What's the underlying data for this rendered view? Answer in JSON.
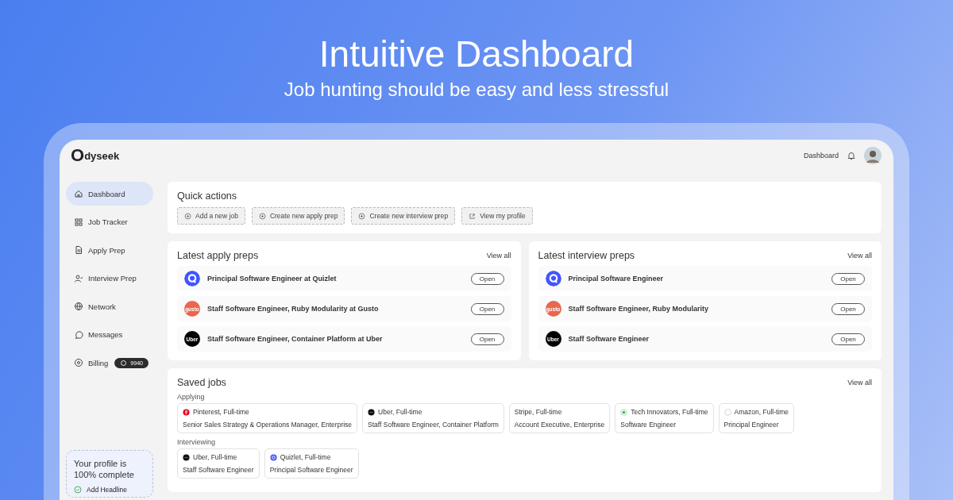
{
  "hero": {
    "title": "Intuitive Dashboard",
    "subtitle": "Job hunting should be easy and less stressful"
  },
  "brand": {
    "mark": "O",
    "name": "dyseek"
  },
  "top_bar": {
    "link": "Dashboard"
  },
  "sidebar": {
    "items": [
      {
        "label": "Dashboard",
        "selected": true
      },
      {
        "label": "Job Tracker",
        "selected": false
      },
      {
        "label": "Apply Prep",
        "selected": false
      },
      {
        "label": "Interview Prep",
        "selected": false
      },
      {
        "label": "Network",
        "selected": false
      },
      {
        "label": "Messages",
        "selected": false
      },
      {
        "label": "Billing",
        "selected": false,
        "badge": "9940"
      }
    ],
    "profile_card": {
      "title": "Your profile is 100% complete",
      "tasks": [
        {
          "label": "Add Headline",
          "checked": true
        }
      ]
    }
  },
  "quick_actions": {
    "title": "Quick actions",
    "buttons": [
      {
        "label": "Add a new job"
      },
      {
        "label": "Create new apply prep"
      },
      {
        "label": "Create new interview prep"
      },
      {
        "label": "View my profile"
      }
    ]
  },
  "prep_panels": [
    {
      "title": "Latest apply preps",
      "link": "View all",
      "rows": [
        {
          "kind": "quizlet",
          "title": "Principal Software Engineer at Quizlet",
          "button": "Open"
        },
        {
          "kind": "gusto",
          "logo_text": "gusto",
          "title": "Staff Software Engineer, Ruby Modularity at Gusto",
          "button": "Open"
        },
        {
          "kind": "uber",
          "logo_text": "Uber",
          "title": "Staff Software Engineer, Container Platform at Uber",
          "button": "Open"
        }
      ]
    },
    {
      "title": "Latest interview preps",
      "link": "View all",
      "rows": [
        {
          "kind": "quizlet",
          "title": "Principal Software Engineer",
          "button": "Open"
        },
        {
          "kind": "gusto",
          "logo_text": "gusto",
          "title": "Staff Software Engineer, Ruby Modularity",
          "button": "Open"
        },
        {
          "kind": "uber",
          "logo_text": "Uber",
          "title": "Staff Software Engineer",
          "button": "Open"
        }
      ]
    }
  ],
  "saved_jobs": {
    "title": "Saved jobs",
    "link": "View all",
    "groups": [
      {
        "label": "Applying",
        "jobs": [
          {
            "kind": "pinterest",
            "company": "Pinterest, Full-time",
            "role": "Senior Sales Strategy & Operations Manager, Enterprise"
          },
          {
            "kind": "uber",
            "company": "Uber, Full-time",
            "role": "Staff Software Engineer, Container Platform"
          },
          {
            "kind": "plain",
            "company": "Stripe, Full-time",
            "role": "Account Executive, Enterprise"
          },
          {
            "kind": "green",
            "company": "Tech Innovators, Full-time",
            "role": "Software Engineer"
          },
          {
            "kind": "empty",
            "company": "Amazon, Full-time",
            "role": "Principal Engineer"
          }
        ]
      },
      {
        "label": "Interviewing",
        "jobs": [
          {
            "kind": "uber",
            "company": "Uber, Full-time",
            "role": "Staff Software Engineer"
          },
          {
            "kind": "quizlet",
            "company": "Quizlet, Full-time",
            "role": "Principal Software Engineer"
          }
        ]
      }
    ]
  }
}
